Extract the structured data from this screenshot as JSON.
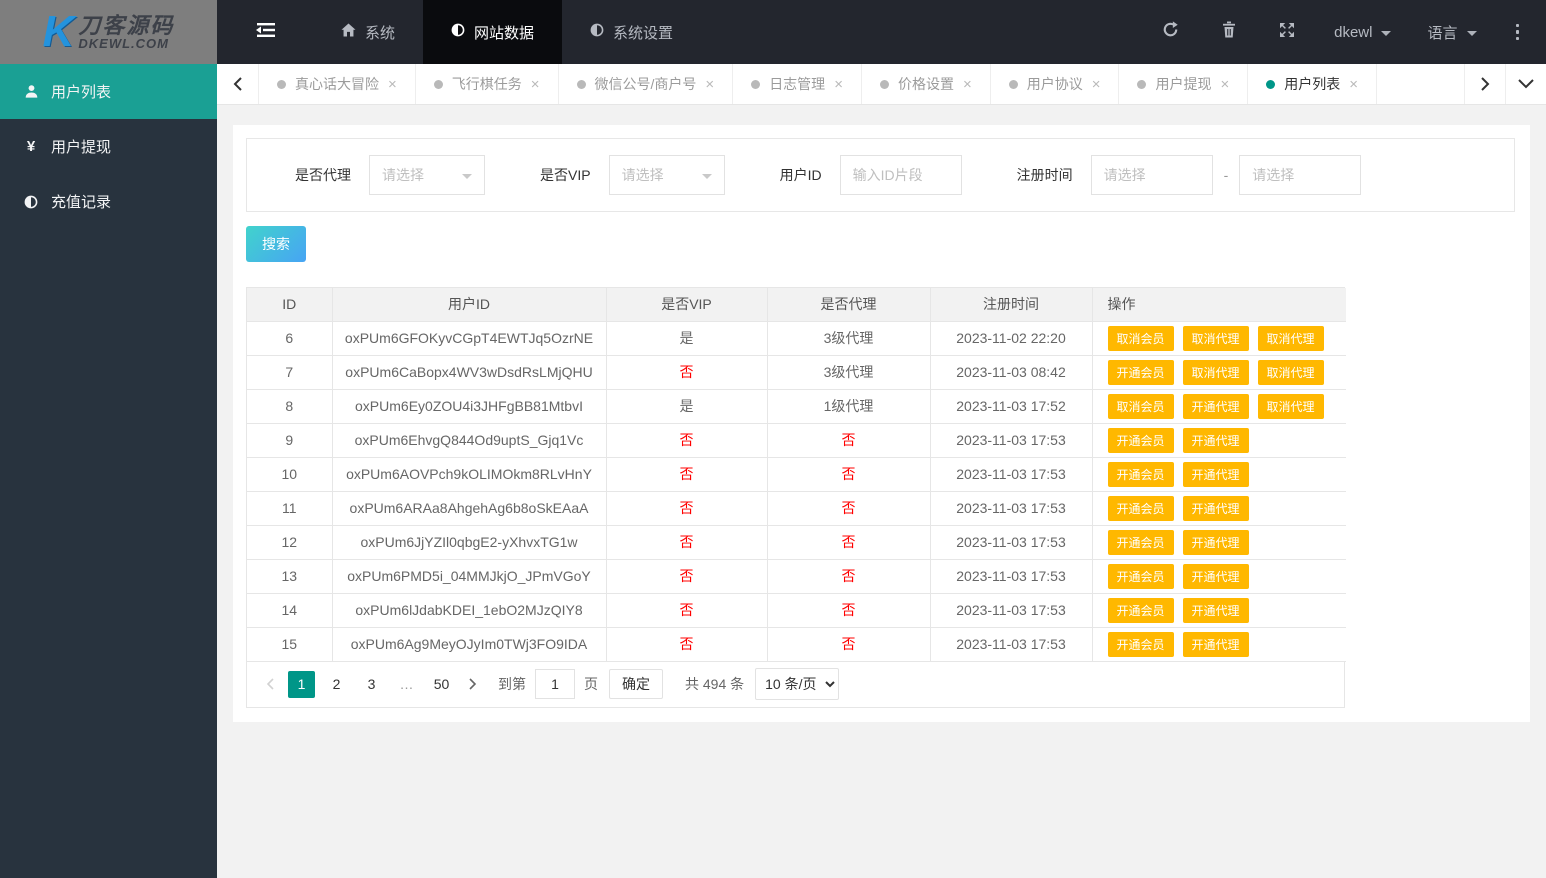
{
  "brand": {
    "title": "刀客源码",
    "subtitle": "DKEWL.COM",
    "mark": "K"
  },
  "topbar": {
    "nav": [
      {
        "label": "系统",
        "icon": "home",
        "active": false
      },
      {
        "label": "网站数据",
        "icon": "half-circle",
        "active": true
      },
      {
        "label": "系统设置",
        "icon": "half-circle",
        "active": false
      }
    ],
    "username": "dkewl",
    "language": "语言",
    "icons": [
      "menu-fold-icon",
      "refresh-icon",
      "trash-icon",
      "fullscreen-icon",
      "more-vertical-icon"
    ]
  },
  "sidebar": {
    "items": [
      {
        "label": "用户列表",
        "icon": "user",
        "active": true
      },
      {
        "label": "用户提现",
        "icon": "yen",
        "active": false
      },
      {
        "label": "充值记录",
        "icon": "half-circle",
        "active": false
      }
    ]
  },
  "tabs": {
    "close_symbol": "×",
    "items": [
      {
        "label": "真心话大冒险",
        "active": false
      },
      {
        "label": "飞行棋任务",
        "active": false
      },
      {
        "label": "微信公号/商户号",
        "active": false
      },
      {
        "label": "日志管理",
        "active": false
      },
      {
        "label": "价格设置",
        "active": false
      },
      {
        "label": "用户协议",
        "active": false
      },
      {
        "label": "用户提现",
        "active": false
      },
      {
        "label": "用户列表",
        "active": true
      }
    ]
  },
  "filters": {
    "agent_label": "是否代理",
    "agent_placeholder": "请选择",
    "vip_label": "是否VIP",
    "vip_placeholder": "请选择",
    "userid_label": "用户ID",
    "userid_placeholder": "输入ID片段",
    "regtime_label": "注册时间",
    "regtime_start_placeholder": "请选择",
    "regtime_separator": "-",
    "regtime_end_placeholder": "请选择",
    "search_label": "搜索"
  },
  "table": {
    "columns": [
      "ID",
      "用户ID",
      "是否VIP",
      "是否代理",
      "注册时间",
      "操作"
    ],
    "rows": [
      {
        "id": "6",
        "user_id": "oxPUm6GFOKyvCGpT4EWTJq5OzrNE",
        "vip": "是",
        "agent": "3级代理",
        "reg_time": "2023-11-02 22:20",
        "actions": [
          "取消会员",
          "取消代理",
          "取消代理"
        ]
      },
      {
        "id": "7",
        "user_id": "oxPUm6CaBopx4WV3wDsdRsLMjQHU",
        "vip": "否",
        "agent": "3级代理",
        "reg_time": "2023-11-03 08:42",
        "actions": [
          "开通会员",
          "取消代理",
          "取消代理"
        ]
      },
      {
        "id": "8",
        "user_id": "oxPUm6Ey0ZOU4i3JHFgBB81MtbvI",
        "vip": "是",
        "agent": "1级代理",
        "reg_time": "2023-11-03 17:52",
        "actions": [
          "取消会员",
          "开通代理",
          "取消代理"
        ]
      },
      {
        "id": "9",
        "user_id": "oxPUm6EhvgQ844Od9uptS_Gjq1Vc",
        "vip": "否",
        "agent": "否",
        "reg_time": "2023-11-03 17:53",
        "actions": [
          "开通会员",
          "开通代理"
        ]
      },
      {
        "id": "10",
        "user_id": "oxPUm6AOVPch9kOLIMOkm8RLvHnY",
        "vip": "否",
        "agent": "否",
        "reg_time": "2023-11-03 17:53",
        "actions": [
          "开通会员",
          "开通代理"
        ]
      },
      {
        "id": "11",
        "user_id": "oxPUm6ARAa8AhgehAg6b8oSkEAaA",
        "vip": "否",
        "agent": "否",
        "reg_time": "2023-11-03 17:53",
        "actions": [
          "开通会员",
          "开通代理"
        ]
      },
      {
        "id": "12",
        "user_id": "oxPUm6JjYZIl0qbgE2-yXhvxTG1w",
        "vip": "否",
        "agent": "否",
        "reg_time": "2023-11-03 17:53",
        "actions": [
          "开通会员",
          "开通代理"
        ]
      },
      {
        "id": "13",
        "user_id": "oxPUm6PMD5i_04MMJkjO_JPmVGoY",
        "vip": "否",
        "agent": "否",
        "reg_time": "2023-11-03 17:53",
        "actions": [
          "开通会员",
          "开通代理"
        ]
      },
      {
        "id": "14",
        "user_id": "oxPUm6lJdabKDEI_1ebO2MJzQIY8",
        "vip": "否",
        "agent": "否",
        "reg_time": "2023-11-03 17:53",
        "actions": [
          "开通会员",
          "开通代理"
        ]
      },
      {
        "id": "15",
        "user_id": "oxPUm6Ag9MeyOJyIm0TWj3FO9IDA",
        "vip": "否",
        "agent": "否",
        "reg_time": "2023-11-03 17:53",
        "actions": [
          "开通会员",
          "开通代理"
        ]
      }
    ]
  },
  "pagination": {
    "pages": [
      {
        "label": "1",
        "active": true
      },
      {
        "label": "2"
      },
      {
        "label": "3"
      },
      {
        "label": "…",
        "ellipsis": true
      },
      {
        "label": "50"
      }
    ],
    "goto_label": "到第",
    "goto_value": "1",
    "page_unit": "页",
    "confirm_label": "确定",
    "total_label": "共 494 条",
    "page_size": "10 条/页"
  },
  "colors": {
    "topbar_bg": "#23262e",
    "sidebar_bg": "#28333e",
    "sidebar_active": "#1aa094",
    "accent_teal": "#009688",
    "action_orange": "#ffb800",
    "danger_red": "#ff0000"
  }
}
